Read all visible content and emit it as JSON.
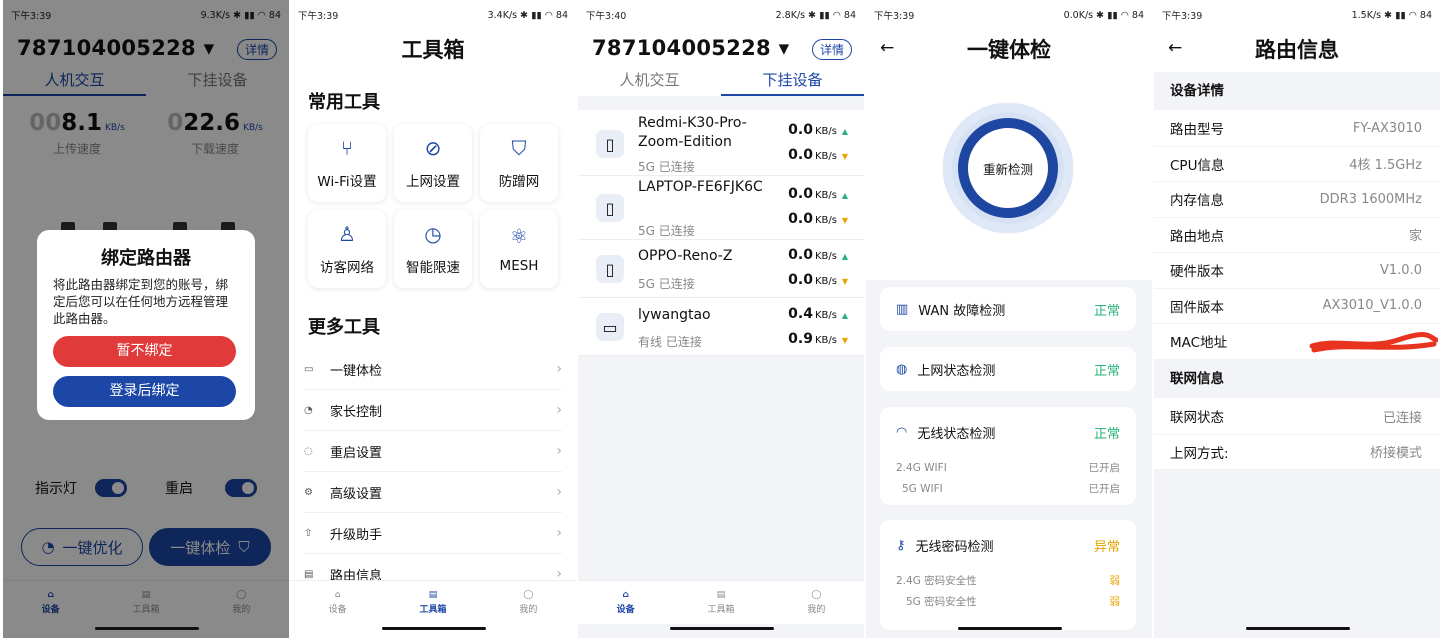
{
  "colors": {
    "accent": "#1d47a6",
    "ok": "#26b37a",
    "warn": "#e6a400",
    "danger": "#e03a3a"
  },
  "screen1": {
    "status": {
      "time": "下午3:39",
      "speed": "9.3K/s",
      "battery": "84"
    },
    "account": "787104005228",
    "detail_label": "详情",
    "tabs": [
      "人机交互",
      "下挂设备"
    ],
    "upload": {
      "ghost": "00",
      "value": "8.1",
      "unit": "KB/s",
      "label": "上传速度"
    },
    "download": {
      "ghost": "0",
      "value": "22.6",
      "unit": "KB/s",
      "label": "下载速度"
    },
    "indicator_label": "指示灯",
    "reboot_label": "重启",
    "optimize_label": "一键优化",
    "checkup_label": "一键体检",
    "modal": {
      "title": "绑定路由器",
      "text": "将此路由器绑定到您的账号，绑定后您可以在任何地方远程管理此路由器。",
      "skip": "暂不绑定",
      "bind": "登录后绑定"
    },
    "nav": [
      "设备",
      "工具箱",
      "我的"
    ]
  },
  "screen2": {
    "status": {
      "time": "下午3:39",
      "speed": "3.4K/s",
      "battery": "84"
    },
    "title": "工具箱",
    "common_title": "常用工具",
    "tools": [
      {
        "label": "Wi-Fi设置",
        "icon": "wifi-settings-icon"
      },
      {
        "label": "上网设置",
        "icon": "internet-settings-icon"
      },
      {
        "label": "防蹭网",
        "icon": "shield-icon"
      },
      {
        "label": "访客网络",
        "icon": "guest-network-icon"
      },
      {
        "label": "智能限速",
        "icon": "speed-limit-icon"
      },
      {
        "label": "MESH",
        "icon": "mesh-icon"
      }
    ],
    "more_title": "更多工具",
    "more": [
      "一键体检",
      "家长控制",
      "重启设置",
      "高级设置",
      "升级助手",
      "路由信息"
    ],
    "nav": [
      "设备",
      "工具箱",
      "我的"
    ]
  },
  "screen3": {
    "status": {
      "time": "下午3:40",
      "speed": "2.8K/s",
      "battery": "84"
    },
    "account": "787104005228",
    "detail_label": "详情",
    "tabs": [
      "人机交互",
      "下挂设备"
    ],
    "devices": [
      {
        "name": "Redmi-K30-Pro-Zoom-Edition",
        "status": "5G 已连接",
        "up": "0.0",
        "down": "0.0",
        "unit": "KB/s"
      },
      {
        "name": "LAPTOP-FE6FJK6C",
        "status": "5G 已连接",
        "up": "0.0",
        "down": "0.0",
        "unit": "KB/s"
      },
      {
        "name": "OPPO-Reno-Z",
        "status": "5G 已连接",
        "up": "0.0",
        "down": "0.0",
        "unit": "KB/s"
      },
      {
        "name": "lywangtao",
        "status": "有线 已连接",
        "up": "0.4",
        "down": "0.9",
        "unit": "KB/s"
      }
    ],
    "nav": [
      "设备",
      "工具箱",
      "我的"
    ]
  },
  "screen4": {
    "status": {
      "time": "下午3:39",
      "speed": "0.0K/s",
      "battery": "84"
    },
    "title": "一键体检",
    "recheck": "重新检测",
    "checks": [
      {
        "label": "WAN 故障检测",
        "status": "正常"
      },
      {
        "label": "上网状态检测",
        "status": "正常"
      },
      {
        "label": "无线状态检测",
        "status": "正常",
        "rows": [
          {
            "k": "2.4G WIFI",
            "v": "已开启"
          },
          {
            "k": "5G  WIFI",
            "v": "已开启"
          }
        ]
      },
      {
        "label": "无线密码检测",
        "status": "异常",
        "rows": [
          {
            "k": "2.4G 密码安全性",
            "v": "弱"
          },
          {
            "k": "5G 密码安全性",
            "v": "弱"
          }
        ]
      }
    ]
  },
  "screen5": {
    "status": {
      "time": "下午3:39",
      "speed": "1.5K/s",
      "battery": "84"
    },
    "title": "路由信息",
    "device_header": "设备详情",
    "device_rows": [
      {
        "k": "路由型号",
        "v": "FY-AX3010"
      },
      {
        "k": "CPU信息",
        "v": "4核 1.5GHz"
      },
      {
        "k": "内存信息",
        "v": "DDR3 1600MHz"
      },
      {
        "k": "路由地点",
        "v": "家"
      },
      {
        "k": "硬件版本",
        "v": "V1.0.0"
      },
      {
        "k": "固件版本",
        "v": "AX3010_V1.0.0"
      },
      {
        "k": "MAC地址",
        "v": ""
      }
    ],
    "net_header": "联网信息",
    "net_rows": [
      {
        "k": "联网状态",
        "v": "已连接"
      },
      {
        "k": "上网方式:",
        "v": "桥接模式"
      }
    ]
  }
}
